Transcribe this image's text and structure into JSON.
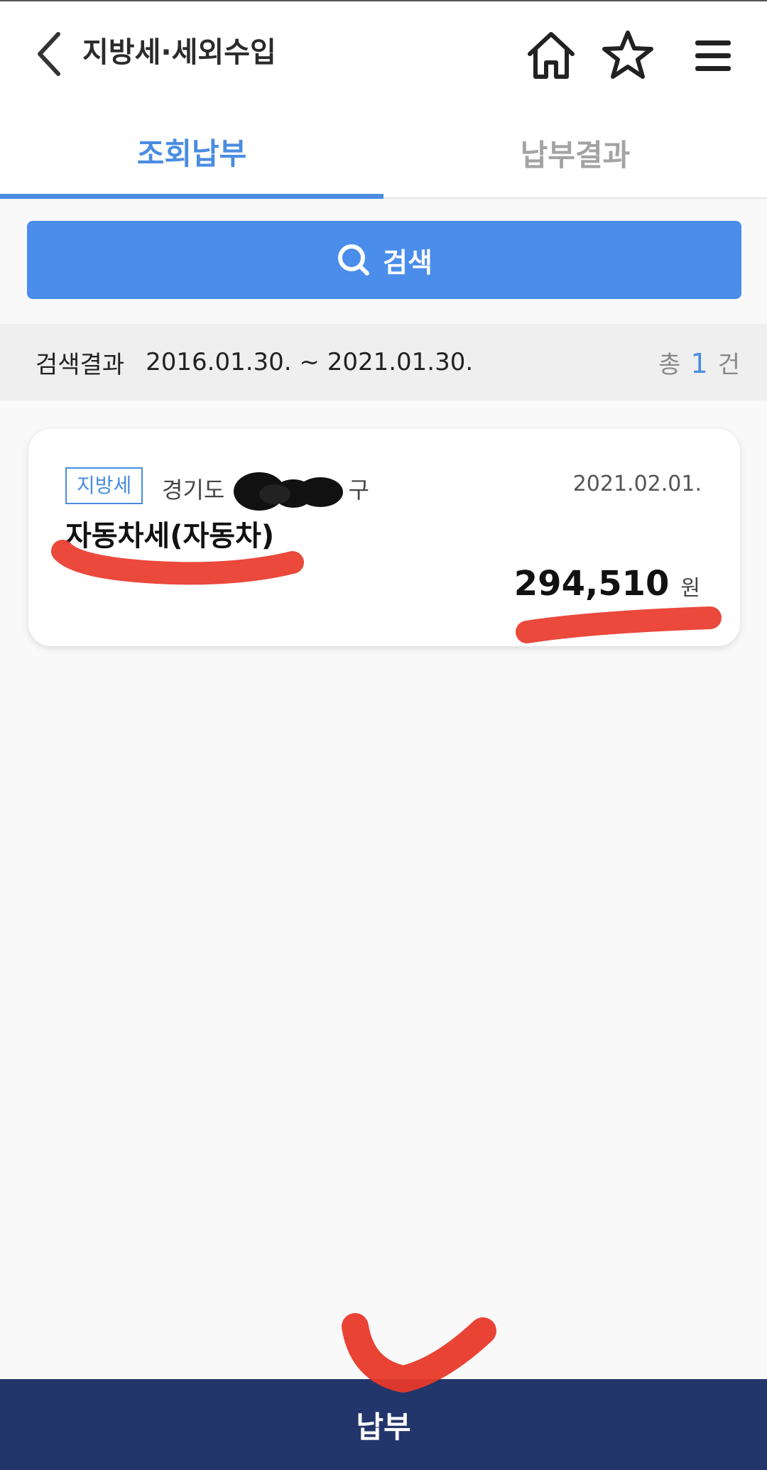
{
  "header": {
    "title": "지방세·세외수입",
    "icons": [
      "back-icon",
      "home-icon",
      "star-icon",
      "menu-icon"
    ]
  },
  "tabs": [
    {
      "label": "조회납부",
      "active": true
    },
    {
      "label": "납부결과",
      "active": false
    }
  ],
  "search": {
    "label": "검색",
    "icon": "search-icon"
  },
  "result_summary": {
    "label": "검색결과",
    "date_range": "2016.01.30. ~ 2021.01.30.",
    "total_prefix": "총",
    "total_count": "1",
    "total_suffix": "건"
  },
  "results": [
    {
      "badge": "지방세",
      "region_prefix": "경기도",
      "region_suffix": "구",
      "due_date": "2021.02.01.",
      "tax_name": "자동차세(자동차)",
      "amount": "294,510",
      "unit": "원"
    }
  ],
  "bottom": {
    "pay_label": "납부"
  },
  "colors": {
    "accent": "#4a8de0",
    "search_button": "#4a8deb",
    "bottom_bar": "#23366b",
    "annotation": "#e8392b"
  }
}
